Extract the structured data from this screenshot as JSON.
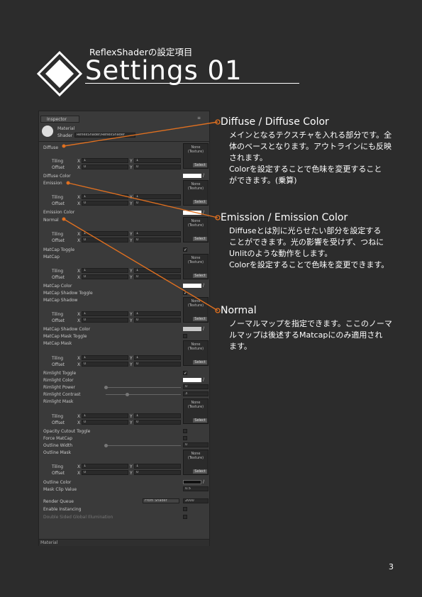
{
  "header": {
    "subtitle": "ReflexShaderの設定項目",
    "title": "Settings 01"
  },
  "inspector": {
    "tab_label": "Inspector",
    "material_name": "Material",
    "shader_label": "Shader",
    "shader_value": "ReflexShader/ReflexShader",
    "none_texture": "None\n(Texture)",
    "select_label": "Select",
    "tiling_label": "Tiling",
    "offset_label": "Offset",
    "x_label": "X",
    "y_label": "Y",
    "tiling_value": "1",
    "offset_value": "0",
    "rows": {
      "diffuse": "Diffuse",
      "diffuse_color": "Diffuse Color",
      "emission": "Emission",
      "emission_color": "Emission Color",
      "normal": "Normal",
      "matcap_toggle": "MatCap Toggle",
      "matcap": "MatCap",
      "matcap_color": "MatCap Color",
      "matcap_shadow_toggle": "MatCap Shadow Toggle",
      "matcap_shadow": "MatCap Shadow",
      "matcap_shadow_color": "MatCap Shadow Color",
      "matcap_mask_toggle": "MatCap Mask Toggle",
      "matcap_mask": "MatCap Mask",
      "rimlight_toggle": "Rimlight Toggle",
      "rimlight_color": "Rimlight Color",
      "rimlight_power": "Rimlight Power",
      "rimlight_contrast": "Rimlight Contrast",
      "rimlight_mask": "Rimlight Mask",
      "opacity_cutout_toggle": "Opacity Cutout Toggle",
      "force_matcap": "Force MatCap",
      "outline_width": "Outline Width",
      "outline_mask": "Outline Mask",
      "outline_color": "Outline Color",
      "mask_clip_value": "Mask Clip Value",
      "render_queue": "Render Queue",
      "enable_instancing": "Enable Instancing",
      "double_sided_gi": "Double Sided Global Illumination"
    },
    "values": {
      "rimlight_power": "0",
      "rimlight_contrast": "3",
      "outline_width": "0",
      "mask_clip_value": "0.5",
      "render_queue_mode": "From Shader",
      "render_queue_value": "2000"
    },
    "footer": "Material"
  },
  "annotations": [
    {
      "title": "Diffuse / Diffuse Color",
      "lines": [
        "メインとなるテクスチャを入れる部分です。全",
        "体のベースとなります。アウトラインにも反映",
        "されます。",
        "Colorを設定することで色味を変更すること",
        "ができます。(乗算)"
      ]
    },
    {
      "title": "Emission / Emission Color",
      "lines": [
        "Diffuseとは別に光らせたい部分を設定する",
        "ことができます。光の影響を受けず、つねに",
        "Unlitのような動作をします。",
        "Colorを設定することで色味を変更できます。"
      ]
    },
    {
      "title": "Normal",
      "lines": [
        "ノーマルマップを指定できます。ここのノーマ",
        "ルマップは後述するMatcapにのみ適用され",
        "ます。"
      ]
    }
  ],
  "page_number": "3",
  "colors": {
    "background": "#2c2c2c",
    "accent": "#e07020",
    "panel": "#3a3a3a"
  }
}
